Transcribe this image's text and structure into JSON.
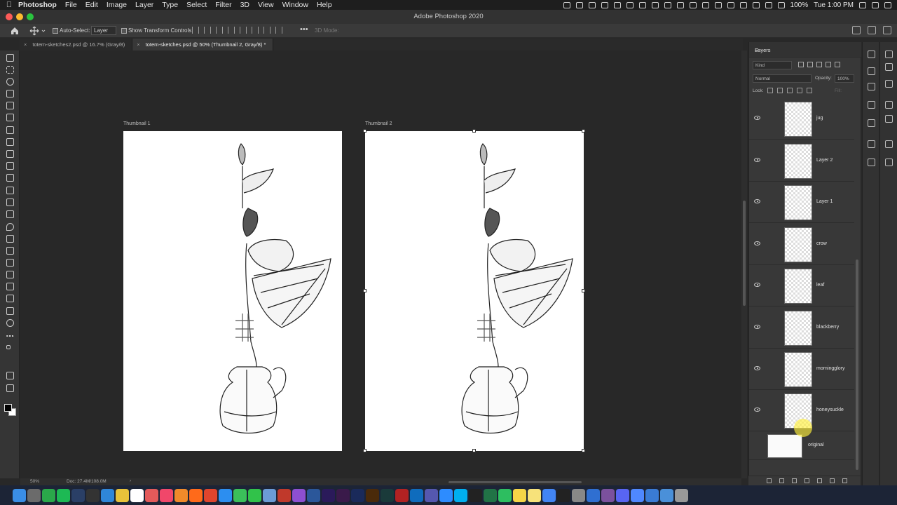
{
  "menubar": {
    "app": "Photoshop",
    "items": [
      "File",
      "Edit",
      "Image",
      "Layer",
      "Type",
      "Select",
      "Filter",
      "3D",
      "View",
      "Window",
      "Help"
    ],
    "battery": "100%",
    "clock": "Tue 1:00 PM"
  },
  "window": {
    "title": "Adobe Photoshop 2020"
  },
  "options": {
    "auto_select_label": "Auto-Select:",
    "auto_select_value": "Layer",
    "transform_label": "Show Transform Controls",
    "mode3d_label": "3D Mode:"
  },
  "tabs": [
    {
      "label": "totem-sketches2.psd @ 16.7% (Gray/8)"
    },
    {
      "label": "totem-sketches.psd @ 50% (Thumbnail 2, Gray/8) *"
    }
  ],
  "artboards": [
    {
      "label": "Thumbnail 1"
    },
    {
      "label": "Thumbnail 2"
    }
  ],
  "status": {
    "zoom": "50%",
    "doc": "Doc: 27.4M/108.0M"
  },
  "layers_panel": {
    "title": "Layers",
    "kind": "Kind",
    "blend_mode": "Normal",
    "opacity_label": "Opacity:",
    "opacity_value": "100%",
    "lock_label": "Lock:",
    "fill_label": "Fill:",
    "layers": [
      {
        "name": "jug"
      },
      {
        "name": "Layer 2"
      },
      {
        "name": "Layer 1"
      },
      {
        "name": "crow"
      },
      {
        "name": "leaf"
      },
      {
        "name": "blackberry"
      },
      {
        "name": "morningglory"
      },
      {
        "name": "honeysuckle"
      },
      {
        "name": "original"
      }
    ]
  },
  "dock_icons": [
    "finder-icon",
    "siri-icon",
    "chrome-icon",
    "spotify-icon",
    "steam-icon",
    "epic-icon",
    "safari-icon",
    "notes-icon",
    "calendar-icon",
    "photos-icon",
    "music-icon",
    "books-icon",
    "firefox-icon",
    "chrome2-icon",
    "mail-icon",
    "maps-icon",
    "messages-icon",
    "preview-icon",
    "acrobat-icon",
    "podcasts-icon",
    "word-icon",
    "premiere-icon",
    "dreamweaver-icon",
    "photoshop-icon",
    "illustrator-icon",
    "audition-icon",
    "filezilla-icon",
    "outlook-icon",
    "teams-icon",
    "zoom-icon",
    "skype-icon",
    "typora-icon",
    "excel-icon",
    "evernote-icon",
    "notes2-icon",
    "stickies-icon",
    "chrome3-icon",
    "davinci-icon",
    "migration-icon",
    "vpn-icon",
    "viber-icon",
    "discord-icon",
    "docs-icon",
    "folder-icon",
    "downloads-icon",
    "trash-icon"
  ]
}
